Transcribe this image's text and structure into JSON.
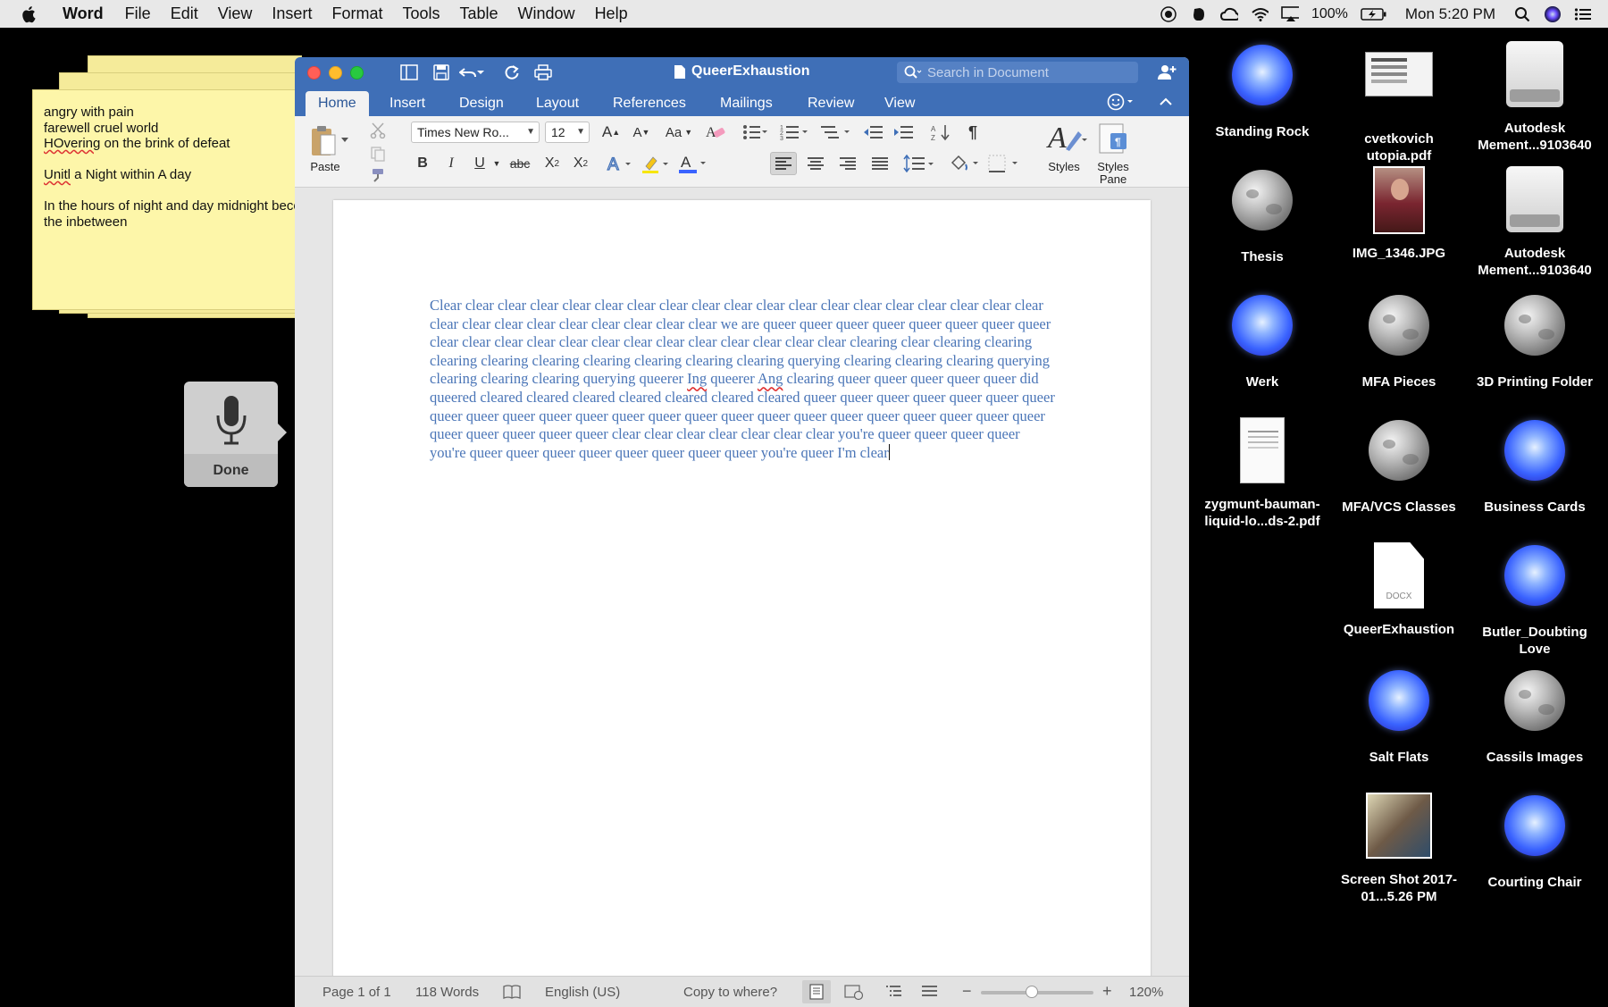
{
  "menubar": {
    "app_name": "Word",
    "items": [
      "File",
      "Edit",
      "View",
      "Insert",
      "Format",
      "Tools",
      "Table",
      "Window",
      "Help"
    ],
    "battery": "100%",
    "clock": "Mon 5:20 PM"
  },
  "sticky": {
    "lines": [
      "angry with pain",
      "farewell cruel world",
      "HOvering on the brink of defeat",
      "",
      "Unitl a Night within A day",
      "",
      "In the hours of night and day midnight becomes",
      "the inbetween"
    ],
    "misspelled": [
      "HOvering",
      "Unitl"
    ]
  },
  "dictation": {
    "done_label": "Done"
  },
  "word": {
    "doc_title": "QueerExhaustion",
    "search_placeholder": "Search in Document",
    "tabs": [
      "Home",
      "Insert",
      "Design",
      "Layout",
      "References",
      "Mailings",
      "Review",
      "View"
    ],
    "active_tab": "Home",
    "ribbon": {
      "paste_label": "Paste",
      "font_name": "Times New Ro...",
      "font_size": "12",
      "styles_label": "Styles",
      "styles_pane_label_1": "Styles",
      "styles_pane_label_2": "Pane",
      "bold": "B",
      "italic": "I",
      "underline": "U",
      "strikethrough": "abc"
    },
    "document": {
      "text_before_spell_1": "Clear clear clear clear clear clear clear clear clear clear clear clear clear clear clear clear clear clear clear clear clear clear clear clear clear clear clear clear we are queer queer queer queer queer queer queer queer clear clear clear clear clear clear clear clear clear clear clear clear clear clearing clear clearing clearing clearing clearing clearing clearing clearing clearing clearing querying clearing clearing clearing querying clearing clearing clearing querying queerer ",
      "spell_1": "Ing",
      "text_between": " queerer ",
      "spell_2": "Ang",
      "text_after": " clearing queer queer queer queer queer did queered cleared cleared cleared cleared cleared cleared cleared queer queer queer queer queer queer queer queer queer queer queer queer queer queer queer queer queer queer queer queer queer queer queer queer queer queer queer queer queer clear clear clear clear clear clear clear you're queer queer queer queer you're queer queer queer queer queer queer queer queer you're queer I'm clear"
    },
    "status": {
      "page": "Page 1 of 1",
      "words": "118 Words",
      "language": "English (US)",
      "copy": "Copy to where?",
      "zoom": "120%",
      "zoom_level": 0.45
    }
  },
  "desktop": [
    {
      "label": "Standing Rock",
      "icon": "blue-orb-icon"
    },
    {
      "label": "cvetkovich utopia.pdf",
      "icon": "pdf-thumbnail-icon"
    },
    {
      "label": "Autodesk Mement...9103640",
      "icon": "drive-icon"
    },
    {
      "label": "Thesis",
      "icon": "moon-folder-icon"
    },
    {
      "label": "IMG_1346.JPG",
      "icon": "photo-thumbnail-icon"
    },
    {
      "label": "Autodesk Mement...9103640",
      "icon": "drive-icon"
    },
    {
      "label": "Werk",
      "icon": "blue-orb-icon"
    },
    {
      "label": "MFA Pieces",
      "icon": "moon-folder-icon"
    },
    {
      "label": "3D Printing Folder",
      "icon": "moon-folder-icon"
    },
    {
      "label": "zygmunt-bauman-liquid-lo...ds-2.pdf",
      "icon": "pdf-document-icon"
    },
    {
      "label": "MFA/VCS Classes",
      "icon": "moon-folder-icon"
    },
    {
      "label": "Business Cards",
      "icon": "blue-orb-icon"
    },
    {
      "label": "QueerExhaustion",
      "icon": "docx-file-icon"
    },
    {
      "label": "Butler_Doubting Love",
      "icon": "blue-orb-icon"
    },
    {
      "label": "Salt Flats",
      "icon": "blue-orb-icon"
    },
    {
      "label": "Cassils Images",
      "icon": "moon-folder-icon"
    },
    {
      "label": "Screen Shot 2017-01...5.26 PM",
      "icon": "screenshot-thumbnail-icon"
    },
    {
      "label": "Courting Chair",
      "icon": "blue-orb-icon"
    }
  ],
  "docx_badge": "DOCX"
}
